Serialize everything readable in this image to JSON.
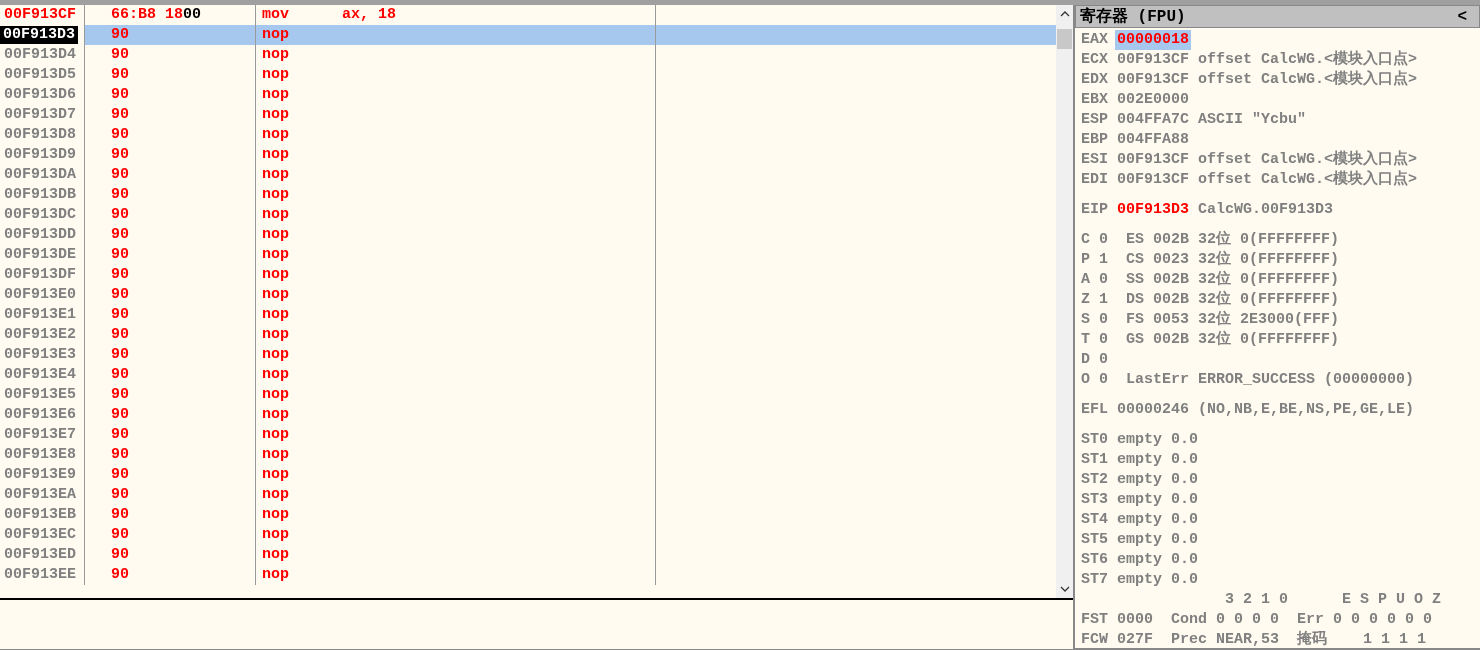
{
  "disassembly": {
    "rows": [
      {
        "address": "00F913CF",
        "bytes": [
          {
            "text": "66:B8 18",
            "modified": true
          },
          {
            "text": "00",
            "modified": false
          }
        ],
        "mnemonic": "mov",
        "operands": "ax, 18",
        "modified": true,
        "selected": false
      },
      {
        "address": "00F913D3",
        "bytes": [
          {
            "text": "90",
            "modified": true
          }
        ],
        "mnemonic": "nop",
        "modified": false,
        "selected": true
      },
      {
        "address": "00F913D4",
        "bytes": [
          {
            "text": "90",
            "modified": true
          }
        ],
        "mnemonic": "nop",
        "modified": false,
        "selected": false
      },
      {
        "address": "00F913D5",
        "bytes": [
          {
            "text": "90",
            "modified": true
          }
        ],
        "mnemonic": "nop",
        "modified": false,
        "selected": false
      },
      {
        "address": "00F913D6",
        "bytes": [
          {
            "text": "90",
            "modified": true
          }
        ],
        "mnemonic": "nop",
        "modified": false,
        "selected": false
      },
      {
        "address": "00F913D7",
        "bytes": [
          {
            "text": "90",
            "modified": true
          }
        ],
        "mnemonic": "nop",
        "modified": false,
        "selected": false
      },
      {
        "address": "00F913D8",
        "bytes": [
          {
            "text": "90",
            "modified": true
          }
        ],
        "mnemonic": "nop",
        "modified": false,
        "selected": false
      },
      {
        "address": "00F913D9",
        "bytes": [
          {
            "text": "90",
            "modified": true
          }
        ],
        "mnemonic": "nop",
        "modified": false,
        "selected": false
      },
      {
        "address": "00F913DA",
        "bytes": [
          {
            "text": "90",
            "modified": true
          }
        ],
        "mnemonic": "nop",
        "modified": false,
        "selected": false
      },
      {
        "address": "00F913DB",
        "bytes": [
          {
            "text": "90",
            "modified": true
          }
        ],
        "mnemonic": "nop",
        "modified": false,
        "selected": false
      },
      {
        "address": "00F913DC",
        "bytes": [
          {
            "text": "90",
            "modified": true
          }
        ],
        "mnemonic": "nop",
        "modified": false,
        "selected": false
      },
      {
        "address": "00F913DD",
        "bytes": [
          {
            "text": "90",
            "modified": true
          }
        ],
        "mnemonic": "nop",
        "modified": false,
        "selected": false
      },
      {
        "address": "00F913DE",
        "bytes": [
          {
            "text": "90",
            "modified": true
          }
        ],
        "mnemonic": "nop",
        "modified": false,
        "selected": false
      },
      {
        "address": "00F913DF",
        "bytes": [
          {
            "text": "90",
            "modified": true
          }
        ],
        "mnemonic": "nop",
        "modified": false,
        "selected": false
      },
      {
        "address": "00F913E0",
        "bytes": [
          {
            "text": "90",
            "modified": true
          }
        ],
        "mnemonic": "nop",
        "modified": false,
        "selected": false
      },
      {
        "address": "00F913E1",
        "bytes": [
          {
            "text": "90",
            "modified": true
          }
        ],
        "mnemonic": "nop",
        "modified": false,
        "selected": false
      },
      {
        "address": "00F913E2",
        "bytes": [
          {
            "text": "90",
            "modified": true
          }
        ],
        "mnemonic": "nop",
        "modified": false,
        "selected": false
      },
      {
        "address": "00F913E3",
        "bytes": [
          {
            "text": "90",
            "modified": true
          }
        ],
        "mnemonic": "nop",
        "modified": false,
        "selected": false
      },
      {
        "address": "00F913E4",
        "bytes": [
          {
            "text": "90",
            "modified": true
          }
        ],
        "mnemonic": "nop",
        "modified": false,
        "selected": false
      },
      {
        "address": "00F913E5",
        "bytes": [
          {
            "text": "90",
            "modified": true
          }
        ],
        "mnemonic": "nop",
        "modified": false,
        "selected": false
      },
      {
        "address": "00F913E6",
        "bytes": [
          {
            "text": "90",
            "modified": true
          }
        ],
        "mnemonic": "nop",
        "modified": false,
        "selected": false
      },
      {
        "address": "00F913E7",
        "bytes": [
          {
            "text": "90",
            "modified": true
          }
        ],
        "mnemonic": "nop",
        "modified": false,
        "selected": false
      },
      {
        "address": "00F913E8",
        "bytes": [
          {
            "text": "90",
            "modified": true
          }
        ],
        "mnemonic": "nop",
        "modified": false,
        "selected": false
      },
      {
        "address": "00F913E9",
        "bytes": [
          {
            "text": "90",
            "modified": true
          }
        ],
        "mnemonic": "nop",
        "modified": false,
        "selected": false
      },
      {
        "address": "00F913EA",
        "bytes": [
          {
            "text": "90",
            "modified": true
          }
        ],
        "mnemonic": "nop",
        "modified": false,
        "selected": false
      },
      {
        "address": "00F913EB",
        "bytes": [
          {
            "text": "90",
            "modified": true
          }
        ],
        "mnemonic": "nop",
        "modified": false,
        "selected": false
      },
      {
        "address": "00F913EC",
        "bytes": [
          {
            "text": "90",
            "modified": true
          }
        ],
        "mnemonic": "nop",
        "modified": false,
        "selected": false
      },
      {
        "address": "00F913ED",
        "bytes": [
          {
            "text": "90",
            "modified": true
          }
        ],
        "mnemonic": "nop",
        "modified": false,
        "selected": false
      },
      {
        "address": "00F913EE",
        "bytes": [
          {
            "text": "90",
            "modified": true
          }
        ],
        "mnemonic": "nop",
        "modified": false,
        "selected": false
      }
    ]
  },
  "registers": {
    "title": "寄存器 (FPU)",
    "collapse": "<",
    "groups": [
      {
        "lines": [
          {
            "label": "EAX",
            "value": "00000018",
            "changed": true,
            "selected": true
          },
          {
            "label": "ECX",
            "value": "00F913CF",
            "comment": "offset CalcWG.<模块入口点>",
            "changed": false,
            "selected": false
          },
          {
            "label": "EDX",
            "value": "00F913CF",
            "comment": "offset CalcWG.<模块入口点>",
            "changed": false,
            "selected": false
          },
          {
            "label": "EBX",
            "value": "002E0000",
            "changed": false,
            "selected": false
          },
          {
            "label": "ESP",
            "value": "004FFA7C",
            "comment": "ASCII \"Ycbu\"",
            "changed": false,
            "selected": false
          },
          {
            "label": "EBP",
            "value": "004FFA88",
            "changed": false,
            "selected": false
          },
          {
            "label": "ESI",
            "value": "00F913CF",
            "comment": "offset CalcWG.<模块入口点>",
            "changed": false,
            "selected": false
          },
          {
            "label": "EDI",
            "value": "00F913CF",
            "comment": "offset CalcWG.<模块入口点>",
            "changed": false,
            "selected": false
          }
        ]
      },
      {
        "lines": [
          {
            "label": "EIP",
            "value": "00F913D3",
            "comment": "CalcWG.00F913D3",
            "changed": true,
            "selected": false
          }
        ]
      },
      {
        "lines": [
          {
            "label": "C",
            "value": "0",
            "comment": " ES 002B 32位 0(FFFFFFFF)",
            "changed": false,
            "selected": false
          },
          {
            "label": "P",
            "value": "1",
            "comment": " CS 0023 32位 0(FFFFFFFF)",
            "changed": false,
            "selected": false
          },
          {
            "label": "A",
            "value": "0",
            "comment": " SS 002B 32位 0(FFFFFFFF)",
            "changed": false,
            "selected": false
          },
          {
            "label": "Z",
            "value": "1",
            "comment": " DS 002B 32位 0(FFFFFFFF)",
            "changed": false,
            "selected": false
          },
          {
            "label": "S",
            "value": "0",
            "comment": " FS 0053 32位 2E3000(FFF)",
            "changed": false,
            "selected": false
          },
          {
            "label": "T",
            "value": "0",
            "comment": " GS 002B 32位 0(FFFFFFFF)",
            "changed": false,
            "selected": false
          },
          {
            "label": "D",
            "value": "0",
            "changed": false,
            "selected": false
          },
          {
            "label": "O",
            "value": "0",
            "comment": " LastErr ERROR_SUCCESS (00000000)",
            "changed": false,
            "selected": false
          }
        ]
      },
      {
        "lines": [
          {
            "label": "EFL",
            "value": "00000246",
            "comment": "(NO,NB,E,BE,NS,PE,GE,LE)",
            "changed": false,
            "selected": false
          }
        ]
      },
      {
        "lines": [
          {
            "label": "ST0",
            "value": "empty",
            "comment": "0.0",
            "changed": false,
            "selected": false
          },
          {
            "label": "ST1",
            "value": "empty",
            "comment": "0.0",
            "changed": false,
            "selected": false
          },
          {
            "label": "ST2",
            "value": "empty",
            "comment": "0.0",
            "changed": false,
            "selected": false
          },
          {
            "label": "ST3",
            "value": "empty",
            "comment": "0.0",
            "changed": false,
            "selected": false
          },
          {
            "label": "ST4",
            "value": "empty",
            "comment": "0.0",
            "changed": false,
            "selected": false
          },
          {
            "label": "ST5",
            "value": "empty",
            "comment": "0.0",
            "changed": false,
            "selected": false
          },
          {
            "label": "ST6",
            "value": "empty",
            "comment": "0.0",
            "changed": false,
            "selected": false
          },
          {
            "label": "ST7",
            "value": "empty",
            "comment": "0.0",
            "changed": false,
            "selected": false
          },
          {
            "comment": "                3 2 1 0      E S P U O Z"
          },
          {
            "label": "FST",
            "value": "0000",
            "comment": " Cond 0 0 0 0  Err 0 0 0 0 0 0",
            "changed": false,
            "selected": false
          },
          {
            "label": "FCW",
            "value": "027F",
            "comment": " Prec NEAR,53  掩码    1 1 1 1",
            "changed": false,
            "selected": false
          }
        ]
      }
    ]
  }
}
